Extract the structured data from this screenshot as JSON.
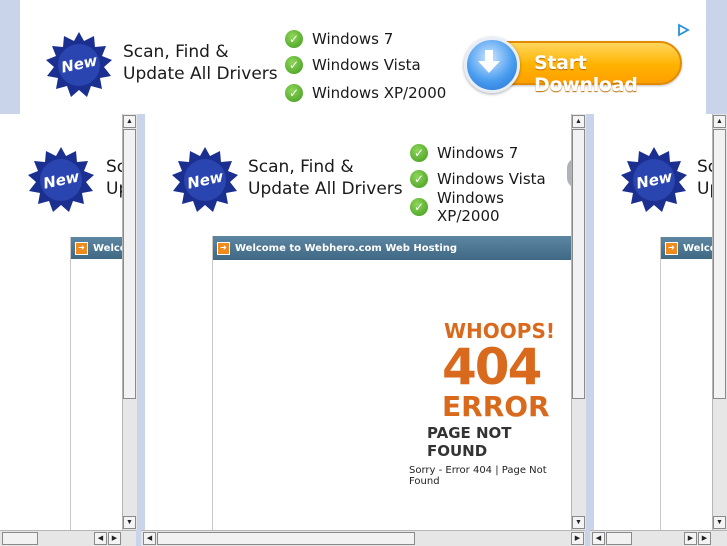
{
  "ad": {
    "badge": "New",
    "headline_line1": "Scan, Find &",
    "headline_line2": "Update All Drivers",
    "os_list": [
      "Windows 7",
      "Windows Vista",
      "Windows XP/2000"
    ],
    "download_label": "Start Download"
  },
  "frame": {
    "header_title": "Welcome to Webhero.com Web Hosting",
    "header_title_clipped": "Welco",
    "headline_clipped_1": "Sc",
    "headline_clipped_2": "Up",
    "error_whoops": "WHOOPS!",
    "error_code": "404",
    "error_word": "ERROR",
    "page_not_found": "PAGE NOT FOUND",
    "sorry_text": "Sorry - Error 404 | Page Not Found"
  },
  "colors": {
    "accent_orange": "#d9691c",
    "header_blue": "#4e7893",
    "badge_navy": "#1a2f8f",
    "check_green": "#4ea61f",
    "button_orange": "#ffb300"
  }
}
